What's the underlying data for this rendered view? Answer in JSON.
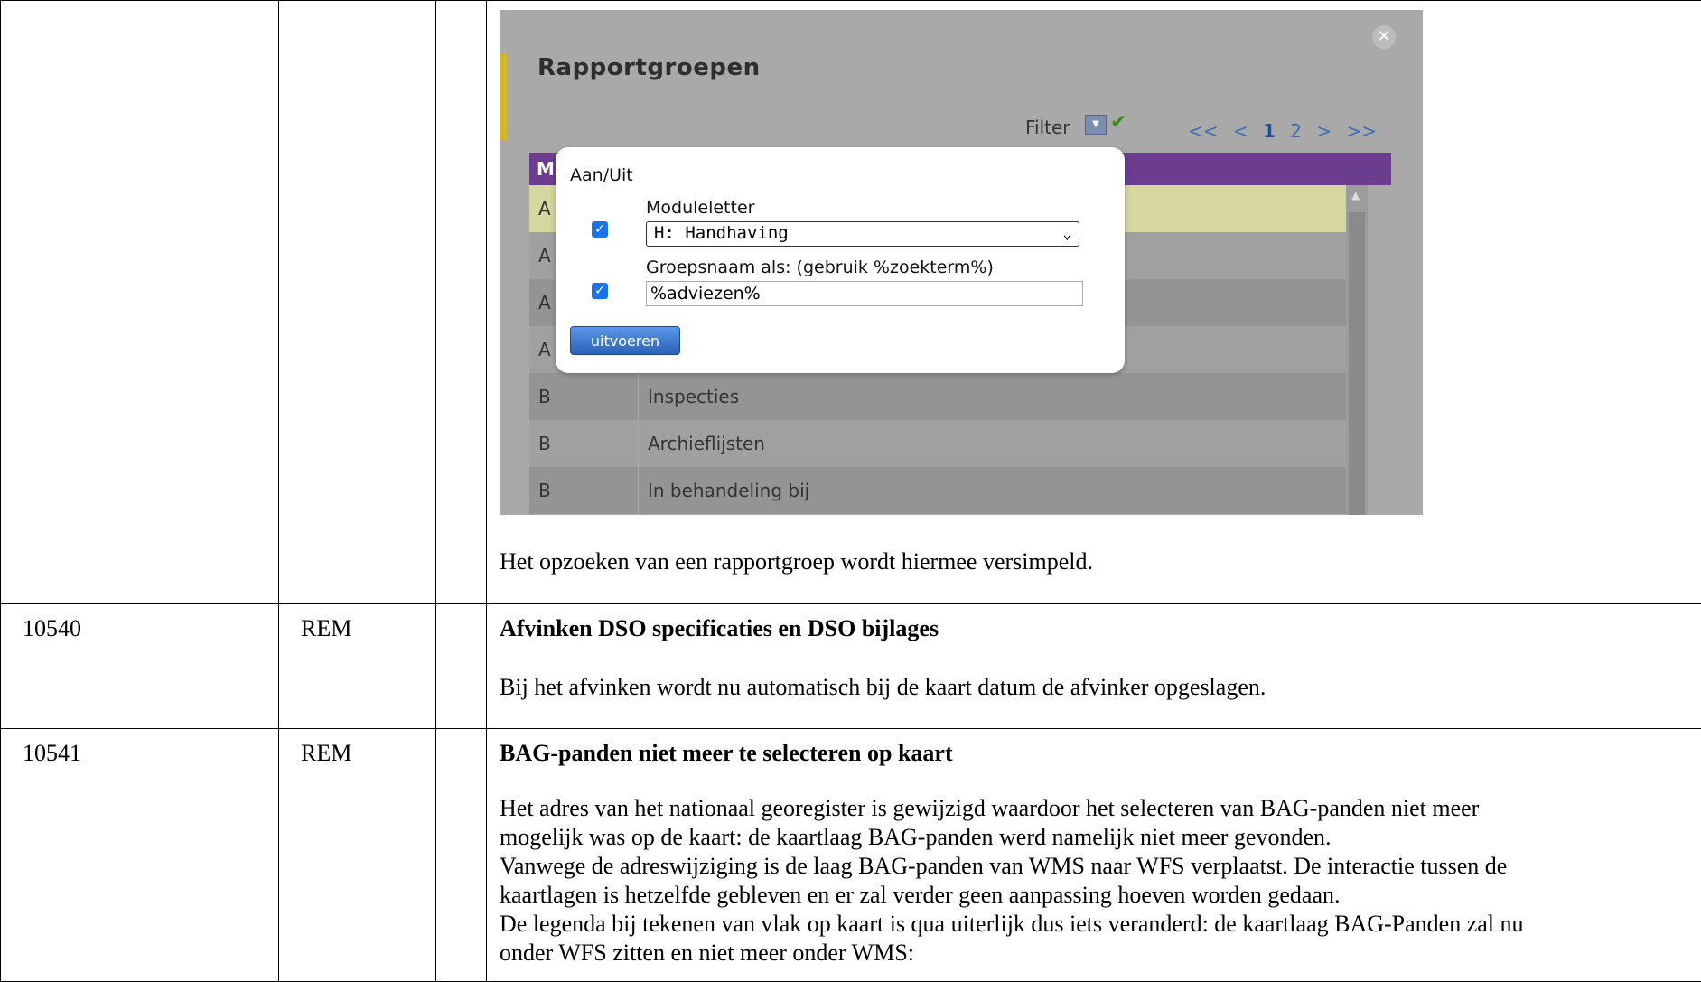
{
  "screenshot": {
    "title": "Rapportgroepen",
    "filter_label": "Filter",
    "pager": {
      "first": "<<",
      "prev": "<",
      "page1": "1",
      "page2": "2",
      "next": ">",
      "last": ">>"
    },
    "header_col1": "M",
    "rows": [
      {
        "col1": "A",
        "col2": ""
      },
      {
        "col1": "A",
        "col2": ""
      },
      {
        "col1": "A",
        "col2": ""
      },
      {
        "col1": "A",
        "col2": ""
      },
      {
        "col1": "B",
        "col2": "Inspecties"
      },
      {
        "col1": "B",
        "col2": "Archieflijsten"
      },
      {
        "col1": "B",
        "col2": "In behandeling bij"
      }
    ],
    "popup": {
      "title": "Aan/Uit",
      "module_label": "Moduleletter",
      "module_value": "H: Handhaving",
      "group_label": "Groepsnaam als: (gebruik %zoekterm%)",
      "group_value": "%adviezen%",
      "execute_label": "uitvoeren"
    },
    "colors": {
      "header": "#6c3d8f",
      "highlight_row": "#d6d6a0",
      "accent": "#d4b62a",
      "button": "#2b62b9"
    }
  },
  "rows": [
    {
      "num": "",
      "type": "",
      "extra": "",
      "body": "Het opzoeken van een rapportgroep wordt hiermee versimpeld."
    },
    {
      "num": "10540",
      "type": "REM",
      "extra": "",
      "title": "Afvinken DSO specificaties en DSO bijlages",
      "body": "Bij het afvinken wordt nu automatisch bij de kaart datum de afvinker opgeslagen."
    },
    {
      "num": "10541",
      "type": "REM",
      "extra": "",
      "title": "BAG-panden niet meer te selecteren op kaart",
      "body_lines": [
        "Het adres van het nationaal georegister is gewijzigd waardoor het selecteren van BAG-panden niet meer",
        "mogelijk was op de kaart: de kaartlaag BAG-panden werd namelijk niet meer gevonden.",
        "Vanwege de adreswijziging is de laag BAG-panden van WMS naar WFS verplaatst. De interactie tussen de",
        "kaartlagen is hetzelfde gebleven en er zal verder geen aanpassing hoeven worden gedaan.",
        "De legenda bij tekenen van vlak op kaart is qua uiterlijk dus iets veranderd: de kaartlaag BAG-Panden zal nu",
        "onder WFS zitten en niet meer onder WMS:"
      ]
    }
  ]
}
